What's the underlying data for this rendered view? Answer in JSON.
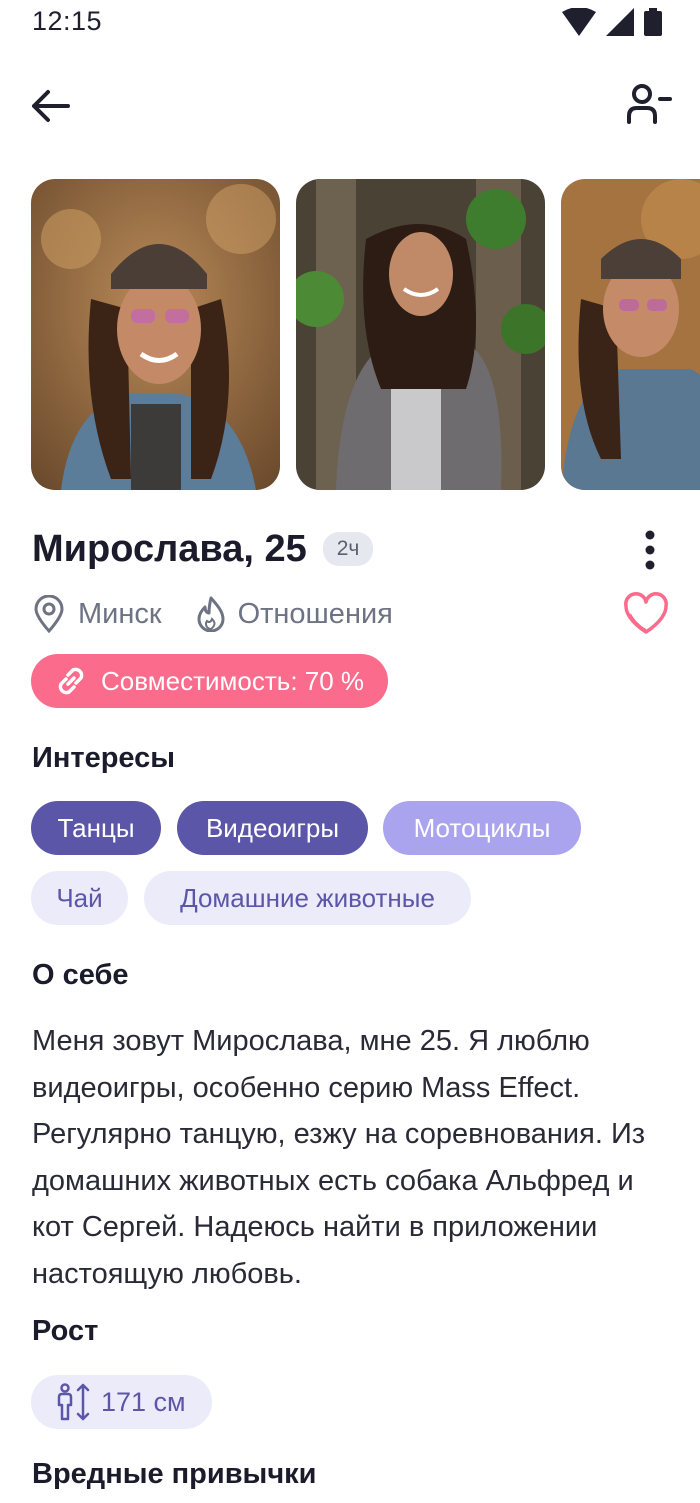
{
  "status_bar": {
    "time": "12:15"
  },
  "profile": {
    "name_age": "Мирослава, 25",
    "last_seen": "2ч",
    "city": "Минск",
    "goal": "Отношения",
    "compatibility": "Совместимость: 70 %"
  },
  "interests": {
    "title": "Интересы",
    "items": [
      {
        "label": "Танцы"
      },
      {
        "label": "Видеоигры"
      },
      {
        "label": "Мотоциклы"
      },
      {
        "label": "Чай"
      },
      {
        "label": "Домашние животные"
      }
    ]
  },
  "about": {
    "title": "О себе",
    "text": "Меня зовут Мирослава, мне 25. Я люблю видеоигры, особенно серию Mass Effect. Регулярно танцую, езжу на соревнования. Из домашних животных есть собака Альфред и кот Сергей. Надеюсь найти в приложении настоящую любовь."
  },
  "height": {
    "title": "Рост",
    "value": "171 см"
  },
  "habits": {
    "title": "Вредные привычки"
  },
  "icons": {
    "back": "arrow-left-icon",
    "remove_user": "user-minus-icon",
    "more": "more-vertical-icon",
    "location": "location-pin-icon",
    "goal": "flame-icon",
    "like": "heart-icon",
    "compatibility": "link-icon",
    "height": "person-height-icon"
  },
  "colors": {
    "accent_pink": "#fb6b8b",
    "chip_dark": "#5c56a9",
    "chip_light": "#aaa4ef",
    "chip_pale": "#ecebfa",
    "text_primary": "#1c1b2b",
    "text_secondary": "#6e7384"
  }
}
